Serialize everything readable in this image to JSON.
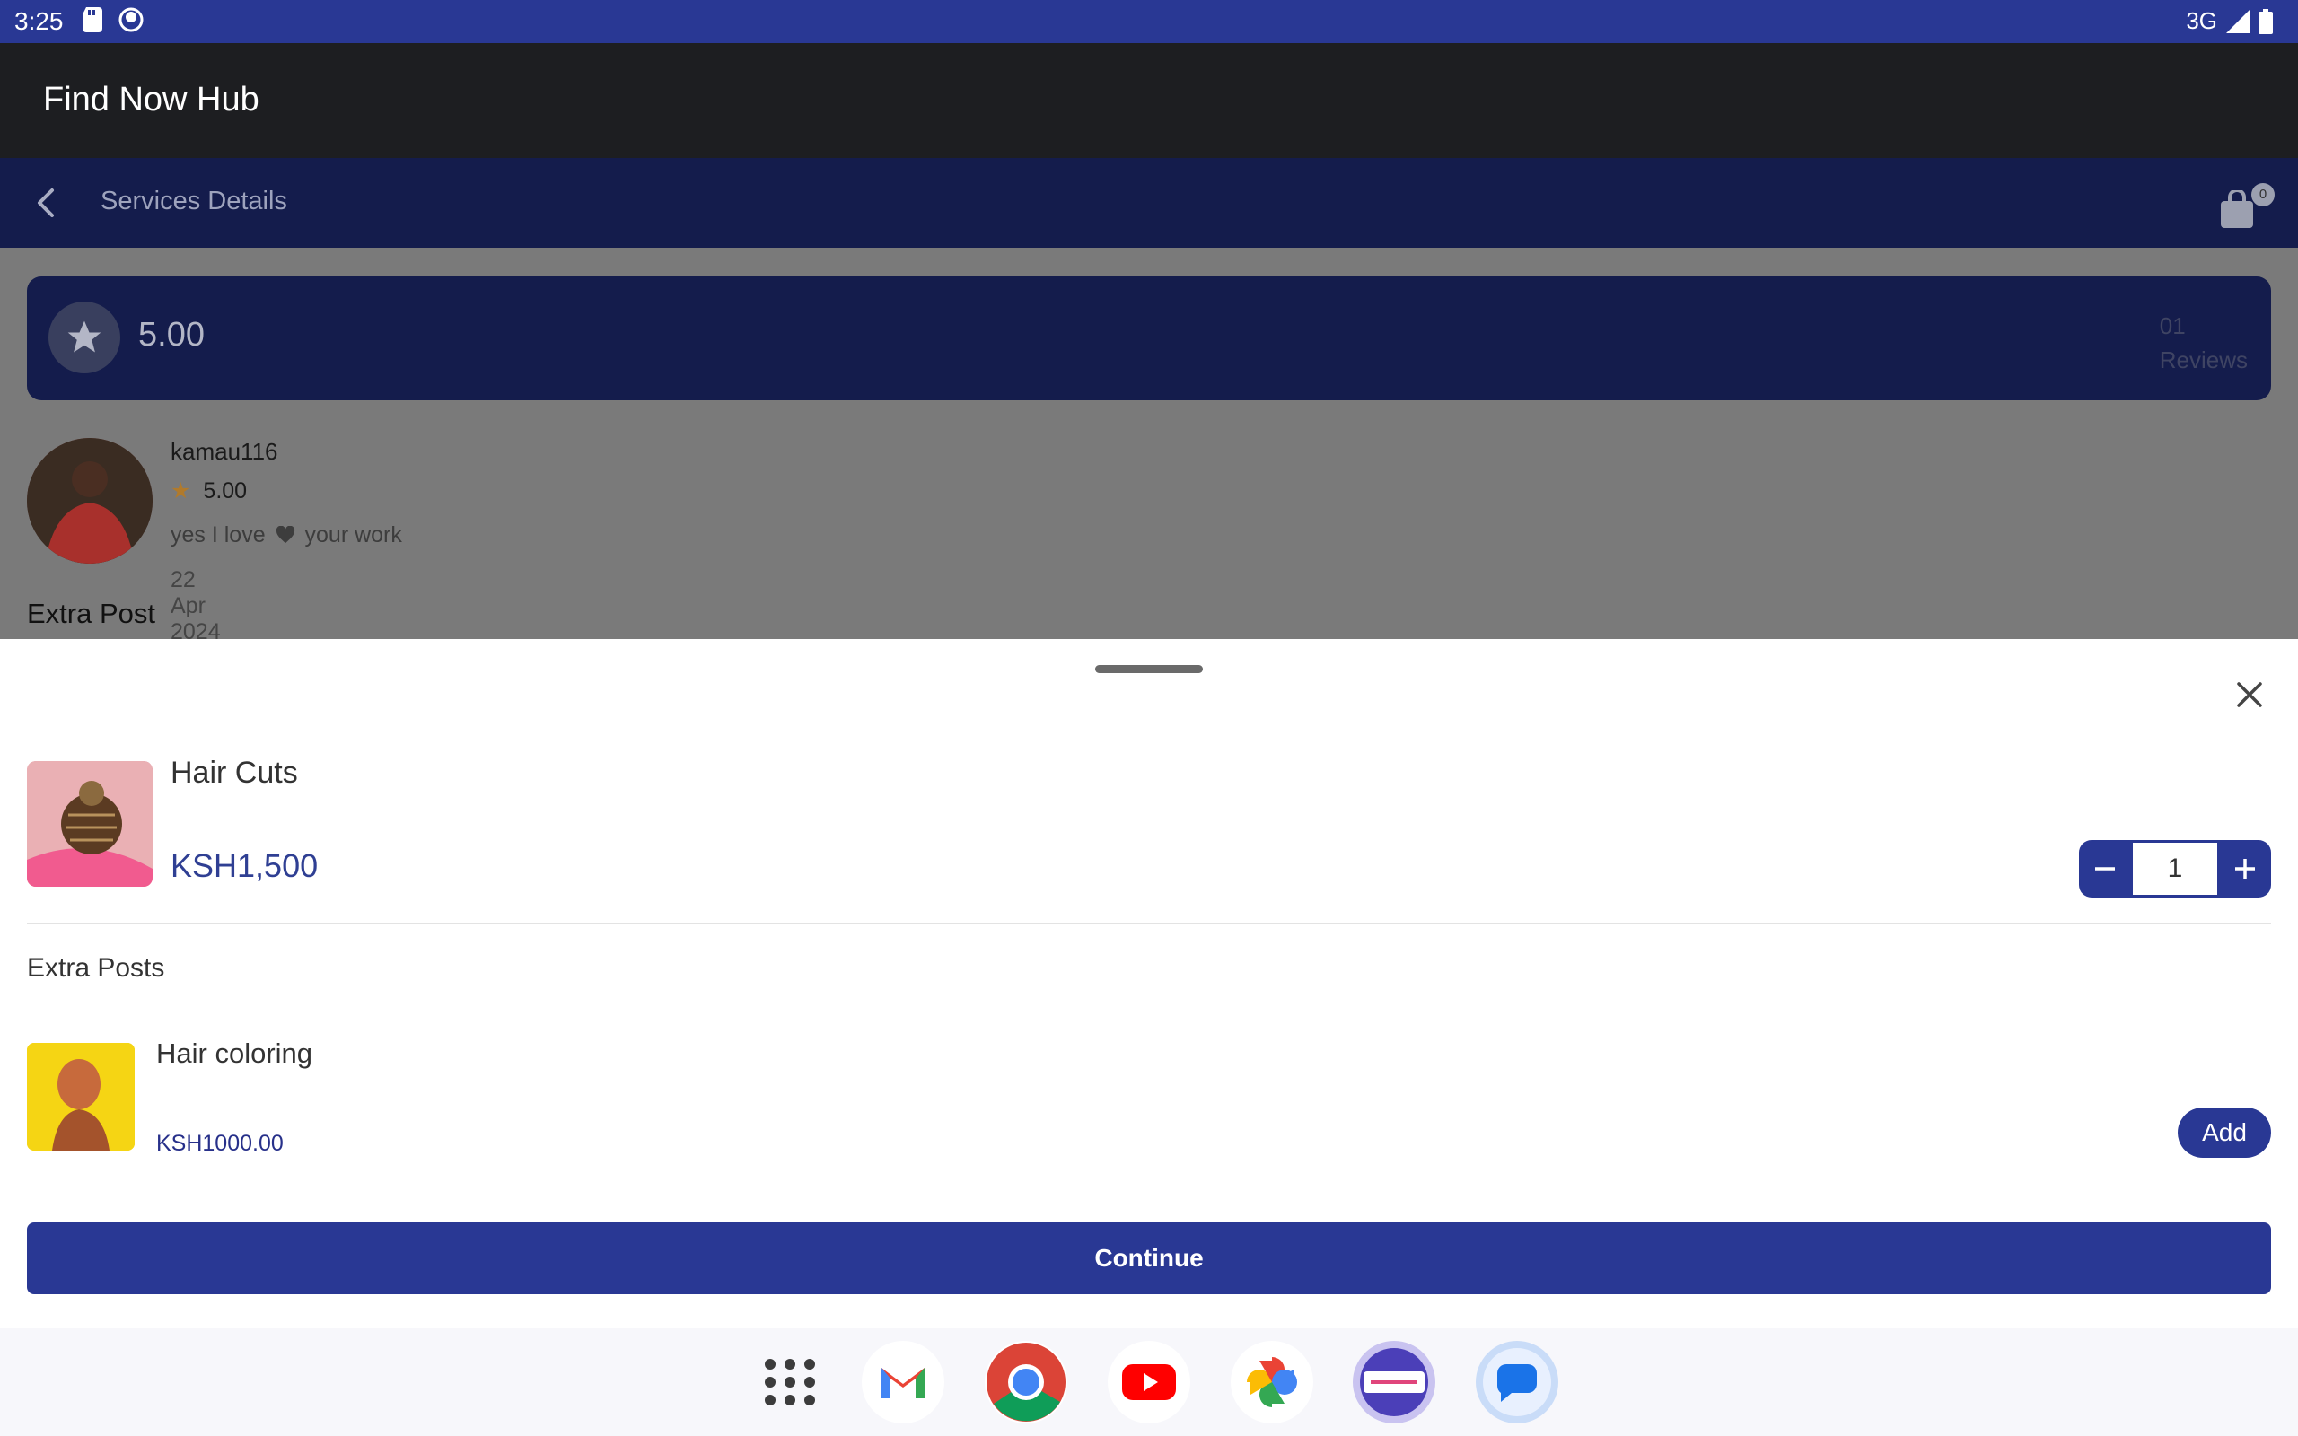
{
  "status_bar": {
    "time": "3:25",
    "network": "3G"
  },
  "app_bar": {
    "title": "Find Now Hub"
  },
  "subheader": {
    "title": "Services Details",
    "cart_count": "0"
  },
  "reviews": {
    "overall_rating": "5.00",
    "count": "01",
    "count_label": "Reviews",
    "items": [
      {
        "username": "kamau116",
        "rating": "5.00",
        "text_before": "yes I love",
        "text_after": "your work",
        "date": "22 Apr 2024"
      }
    ]
  },
  "extra_post_heading": "Extra Post",
  "sheet": {
    "item": {
      "name": "Hair Cuts",
      "price": "KSH1,500",
      "quantity": "1"
    },
    "extras_heading": "Extra Posts",
    "extras": [
      {
        "name": "Hair coloring",
        "price": "KSH1000.00",
        "button_label": "Add"
      }
    ],
    "continue_label": "Continue"
  },
  "dock": [
    "apps-icon",
    "gmail-icon",
    "chrome-icon",
    "youtube-icon",
    "photos-icon",
    "findnow-app-icon",
    "messages-icon"
  ],
  "colors": {
    "primary": "#293894",
    "dark_navy": "#141c4c",
    "app_bar": "#1d1e21"
  }
}
